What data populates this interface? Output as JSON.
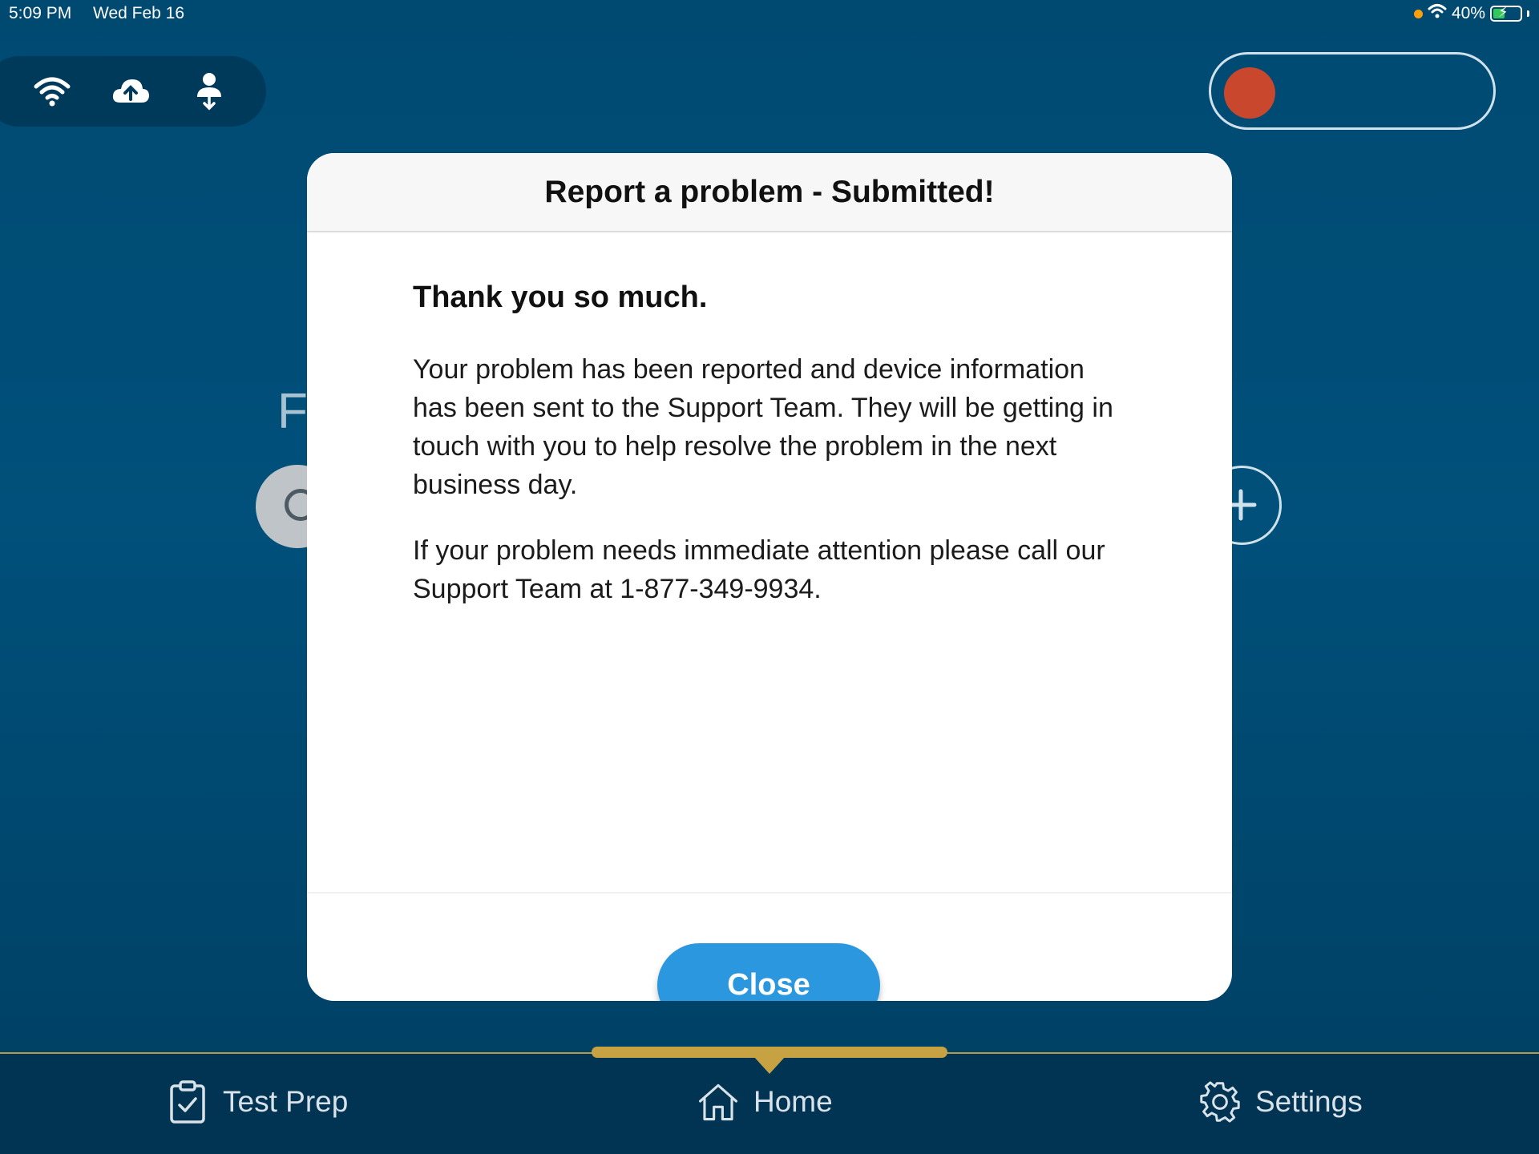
{
  "status_bar": {
    "time": "5:09 PM",
    "date": "Wed Feb 16",
    "battery": "40%"
  },
  "icons": {
    "wifi": "wifi-icon",
    "cloud_upload": "cloud-upload-icon",
    "user_sync": "user-download-icon"
  },
  "background": {
    "partial_letter": "F"
  },
  "modal": {
    "title": "Report a problem - Submitted!",
    "heading": "Thank you so much.",
    "paragraph_1": "Your problem has been reported and device information has been sent to the Support Team. They will be getting in touch with you to help resolve the problem in the next business day.",
    "paragraph_2": "If your problem needs immediate attention please call our Support Team at 1-877-349-9934.",
    "close_label": "Close"
  },
  "tabs": [
    {
      "label": "Test Prep",
      "icon": "clipboard-check-icon"
    },
    {
      "label": "Home",
      "icon": "home-icon",
      "selected": true
    },
    {
      "label": "Settings",
      "icon": "gear-icon"
    }
  ],
  "colors": {
    "accent": "#2b97de",
    "tab_indicator": "#c6a243",
    "record": "#c8472d",
    "background": "#00507b"
  }
}
